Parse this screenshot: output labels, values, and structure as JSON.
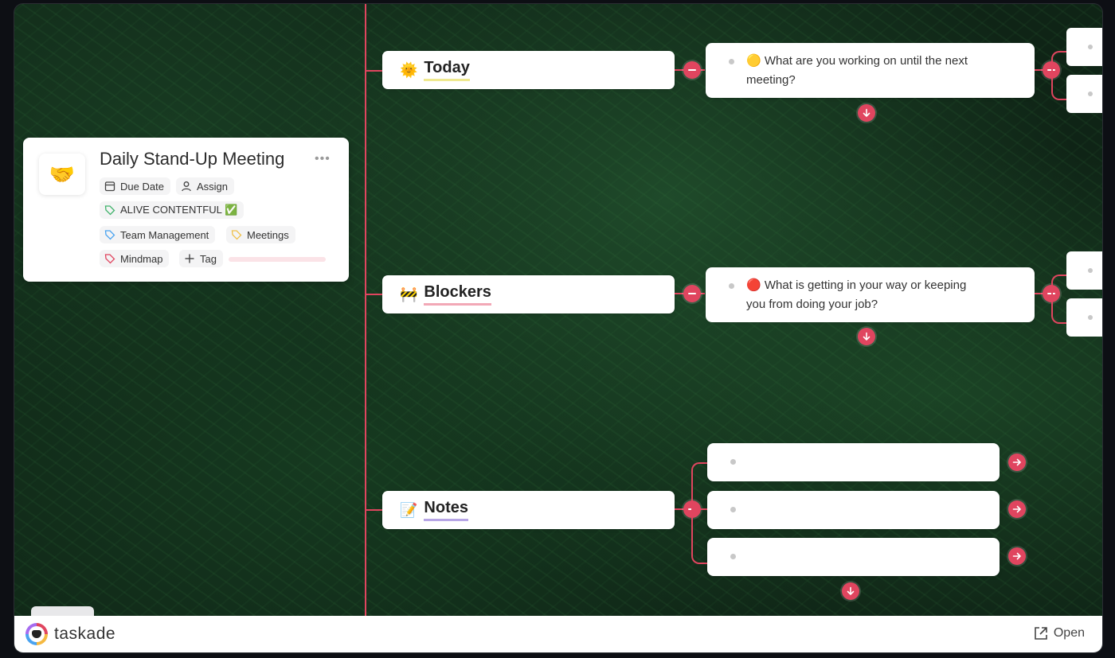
{
  "title_card": {
    "emoji": "🤝",
    "title": "Daily Stand-Up Meeting",
    "more": "•••",
    "fields": {
      "due_date": "Due Date",
      "assign": "Assign"
    },
    "tags": [
      {
        "label": "ALIVE CONTENTFUL ✅",
        "color": "#3fb26a"
      },
      {
        "label": "Team Management",
        "color": "#4aa3f0"
      },
      {
        "label": "Meetings",
        "color": "#f0c14a"
      },
      {
        "label": "Mindmap",
        "color": "#e0455f"
      }
    ],
    "add_tag": "Tag"
  },
  "branches": [
    {
      "emoji": "🌞",
      "title": "Today",
      "question_emoji": "🟡",
      "question": "What are you working on until the next meeting?"
    },
    {
      "emoji": "🚧",
      "title": "Blockers",
      "question_emoji": "🔴",
      "question": "What is getting in your way or keeping you from doing your job?"
    },
    {
      "emoji": "📝",
      "title": "Notes"
    }
  ],
  "footer": {
    "brand": "taskade",
    "open": "Open"
  },
  "colors": {
    "accent": "#e0455f"
  }
}
